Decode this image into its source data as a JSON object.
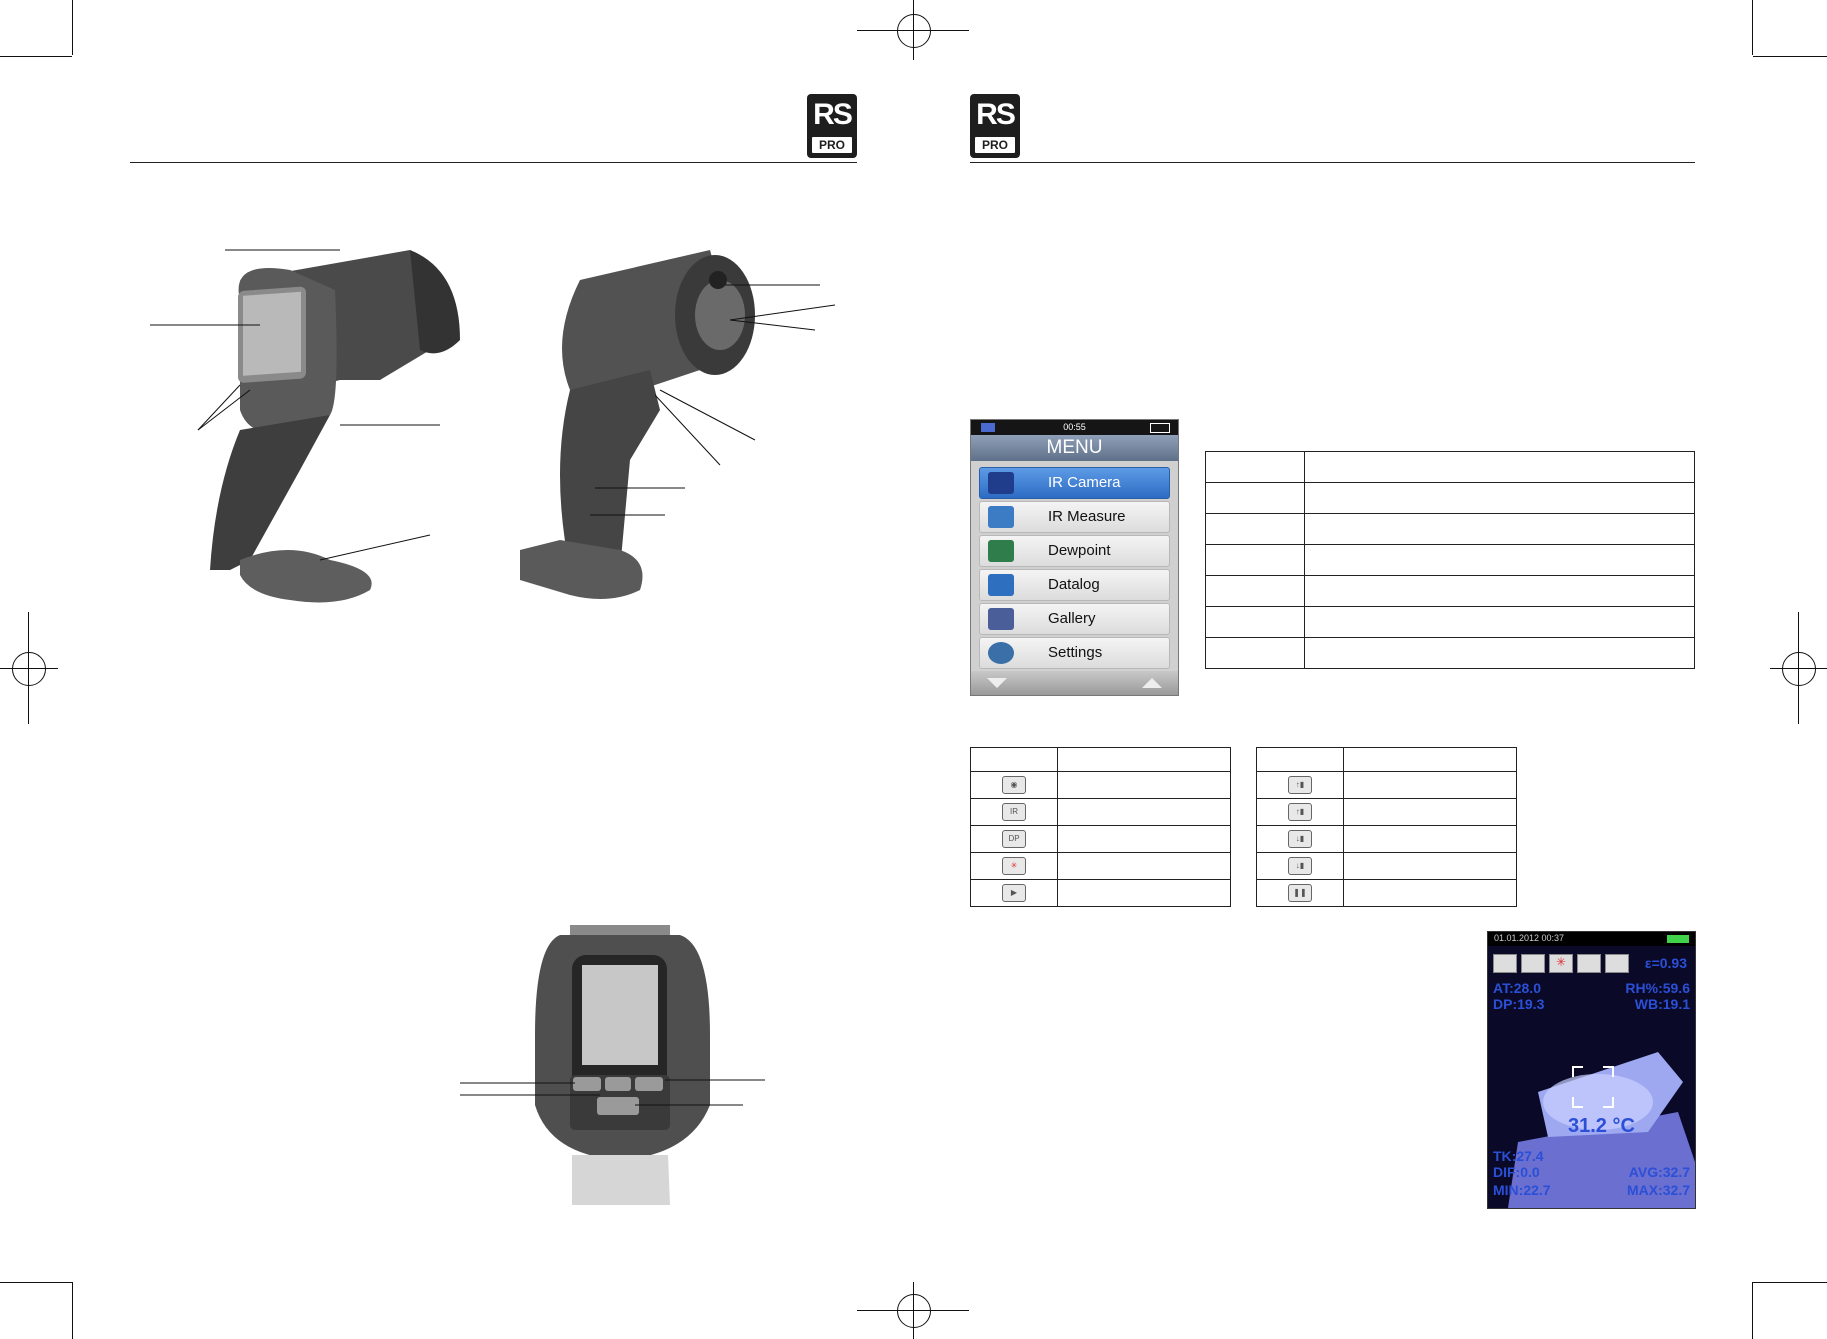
{
  "logo": {
    "top": "RS",
    "bottom": "PRO"
  },
  "menu_screen": {
    "time": "00:55",
    "title": "MENU",
    "items": [
      {
        "label": "IR Camera",
        "icon": "camera-icon"
      },
      {
        "label": "IR Measure",
        "icon": "thermometer-icon"
      },
      {
        "label": "Dewpoint",
        "icon": "dewpoint-icon"
      },
      {
        "label": "Datalog",
        "icon": "datalog-icon"
      },
      {
        "label": "Gallery",
        "icon": "floppy-disk-icon"
      },
      {
        "label": "Settings",
        "icon": "gear-icon"
      }
    ]
  },
  "table_left_icons": [
    "IR",
    "DP"
  ],
  "thermal_screen": {
    "datetime": "01.01.2012  00:37",
    "emissivity": "ε=0.93",
    "at": "AT:28.0",
    "rh": "RH%:59.6",
    "dp": "DP:19.3",
    "wb": "WB:19.1",
    "center": "31.2 °C",
    "tk": "TK:27.4",
    "dif": "DIF:0.0",
    "min": "MIN:22.7",
    "avg": "AVG:32.7",
    "max": "MAX:32.7"
  }
}
